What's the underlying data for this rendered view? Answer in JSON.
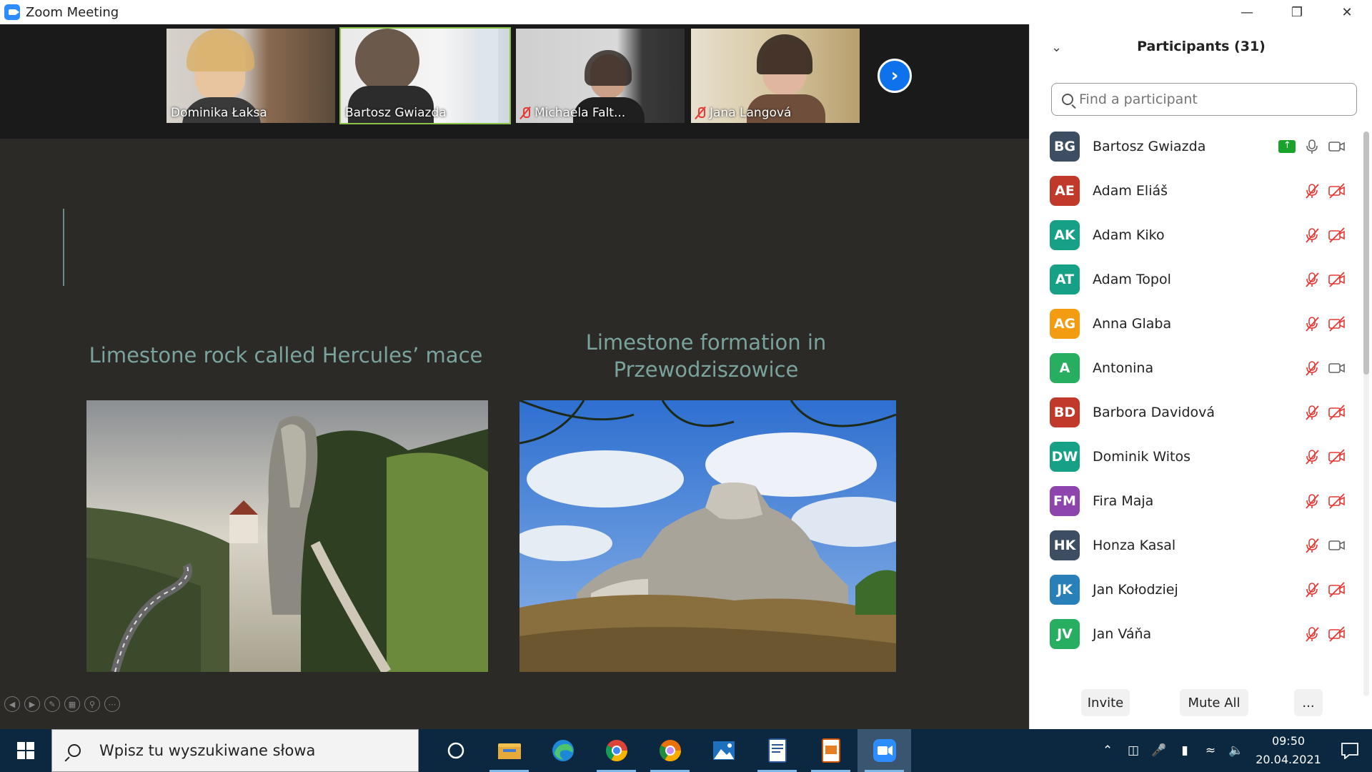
{
  "window": {
    "title": "Zoom Meeting"
  },
  "video_tiles": [
    {
      "name": "Dominika Łaksa",
      "muted": false,
      "active": false
    },
    {
      "name": "Bartosz Gwiazda",
      "muted": false,
      "active": true
    },
    {
      "name": "Michaela Falt...",
      "muted": true,
      "active": false
    },
    {
      "name": "Jana Langová",
      "muted": true,
      "active": false
    }
  ],
  "slide": {
    "caption_left": "Limestone rock called Hercules’ mace",
    "caption_right_line1": "Limestone formation in",
    "caption_right_line2": "Przewodziszowice"
  },
  "participants_panel": {
    "title": "Participants (31)",
    "search_placeholder": "Find a participant",
    "participants": [
      {
        "initials": "BG",
        "name": "Bartosz Gwiazda",
        "color": "#3d4e63",
        "mic": "on",
        "video": "on",
        "sharing": true
      },
      {
        "initials": "AE",
        "name": "Adam Eliáš",
        "color": "#c0392b",
        "mic": "muted",
        "video": "off",
        "sharing": false
      },
      {
        "initials": "AK",
        "name": "Adam Kiko",
        "color": "#16a085",
        "mic": "muted",
        "video": "off",
        "sharing": false
      },
      {
        "initials": "AT",
        "name": "Adam Topol",
        "color": "#16a085",
        "mic": "muted",
        "video": "off",
        "sharing": false
      },
      {
        "initials": "AG",
        "name": "Anna Glaba",
        "color": "#f39c12",
        "mic": "muted",
        "video": "off",
        "sharing": false
      },
      {
        "initials": "A",
        "name": "Antonina",
        "color": "#27ae60",
        "mic": "muted",
        "video": "on",
        "sharing": false
      },
      {
        "initials": "BD",
        "name": "Barbora Davidová",
        "color": "#c0392b",
        "mic": "muted",
        "video": "off",
        "sharing": false
      },
      {
        "initials": "DW",
        "name": "Dominik Witos",
        "color": "#16a085",
        "mic": "muted",
        "video": "off",
        "sharing": false
      },
      {
        "initials": "FM",
        "name": "Fira Maja",
        "color": "#8e44ad",
        "mic": "muted",
        "video": "off",
        "sharing": false
      },
      {
        "initials": "HK",
        "name": "Honza Kasal",
        "color": "#3d4e63",
        "mic": "muted",
        "video": "on",
        "sharing": false
      },
      {
        "initials": "JK",
        "name": "Jan Kołodziej",
        "color": "#2980b9",
        "mic": "muted",
        "video": "off",
        "sharing": false
      },
      {
        "initials": "JV",
        "name": "Jan Váňa",
        "color": "#27ae60",
        "mic": "muted",
        "video": "off",
        "sharing": false
      }
    ],
    "buttons": {
      "invite": "Invite",
      "mute_all": "Mute All",
      "more": "..."
    }
  },
  "taskbar": {
    "search_placeholder": "Wpisz tu wyszukiwane słowa",
    "time": "09:50",
    "date": "20.04.2021"
  },
  "colors": {
    "accent": "#0e72ed",
    "muted_red": "#e53935",
    "share_green": "#1aa32c"
  }
}
